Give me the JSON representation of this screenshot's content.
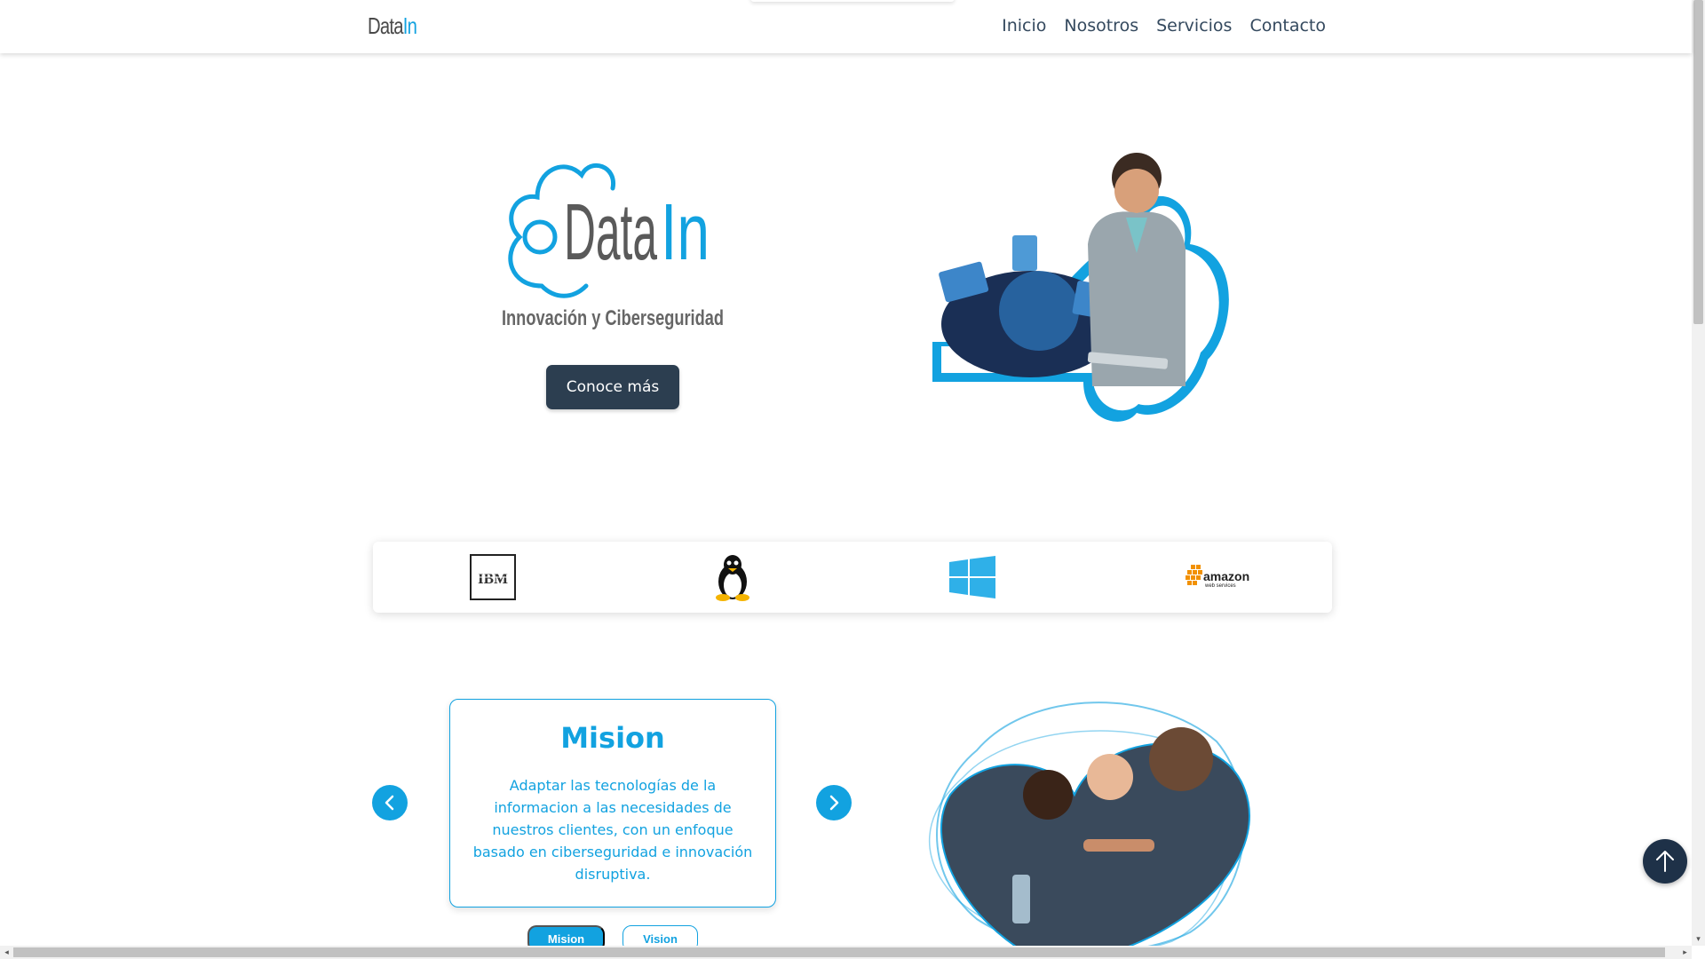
{
  "brand": {
    "part1": "Data",
    "part2": "In"
  },
  "nav": {
    "items": [
      "Inicio",
      "Nosotros",
      "Servicios",
      "Contacto"
    ]
  },
  "hero": {
    "logo_text_1": "Data",
    "logo_text_2": "In",
    "tagline": "Innovación y Ciberseguridad",
    "cta_label": "Conoce más"
  },
  "partners": {
    "ibm_label": "IBM",
    "aws_label_1": "amazon",
    "aws_label_2": "web services"
  },
  "mission": {
    "title": "Mision",
    "text": "Adaptar las tecnologías de la informacion a las necesidades de nuestros clientes, con un enfoque basado en ciberseguridad e innovación disruptiva.",
    "tab_mision": "Mision",
    "tab_vision": "Vision"
  },
  "colors": {
    "accent": "#12a2e0",
    "dark": "#2c3e50",
    "back_top": "#1e3148"
  }
}
